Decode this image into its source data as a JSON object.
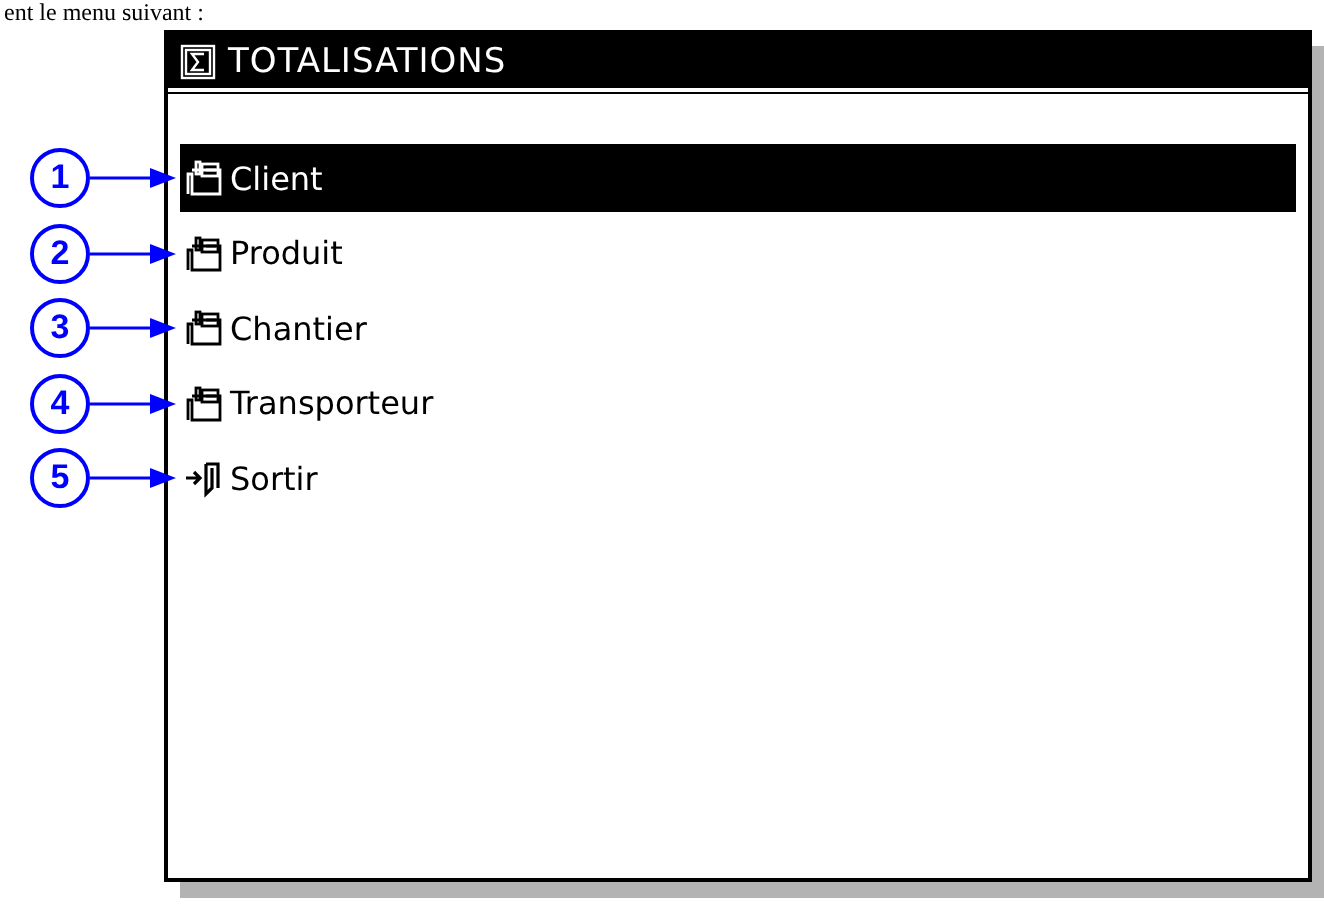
{
  "caption": "ent le menu suivant :",
  "window": {
    "title": "TOTALISATIONS"
  },
  "menu": {
    "items": [
      {
        "label": "Client",
        "kind": "folder",
        "selected": true
      },
      {
        "label": "Produit",
        "kind": "folder",
        "selected": false
      },
      {
        "label": "Chantier",
        "kind": "folder",
        "selected": false
      },
      {
        "label": "Transporteur",
        "kind": "folder",
        "selected": false
      },
      {
        "label": "Sortir",
        "kind": "exit",
        "selected": false
      }
    ]
  },
  "callouts": [
    "1",
    "2",
    "3",
    "4",
    "5"
  ]
}
